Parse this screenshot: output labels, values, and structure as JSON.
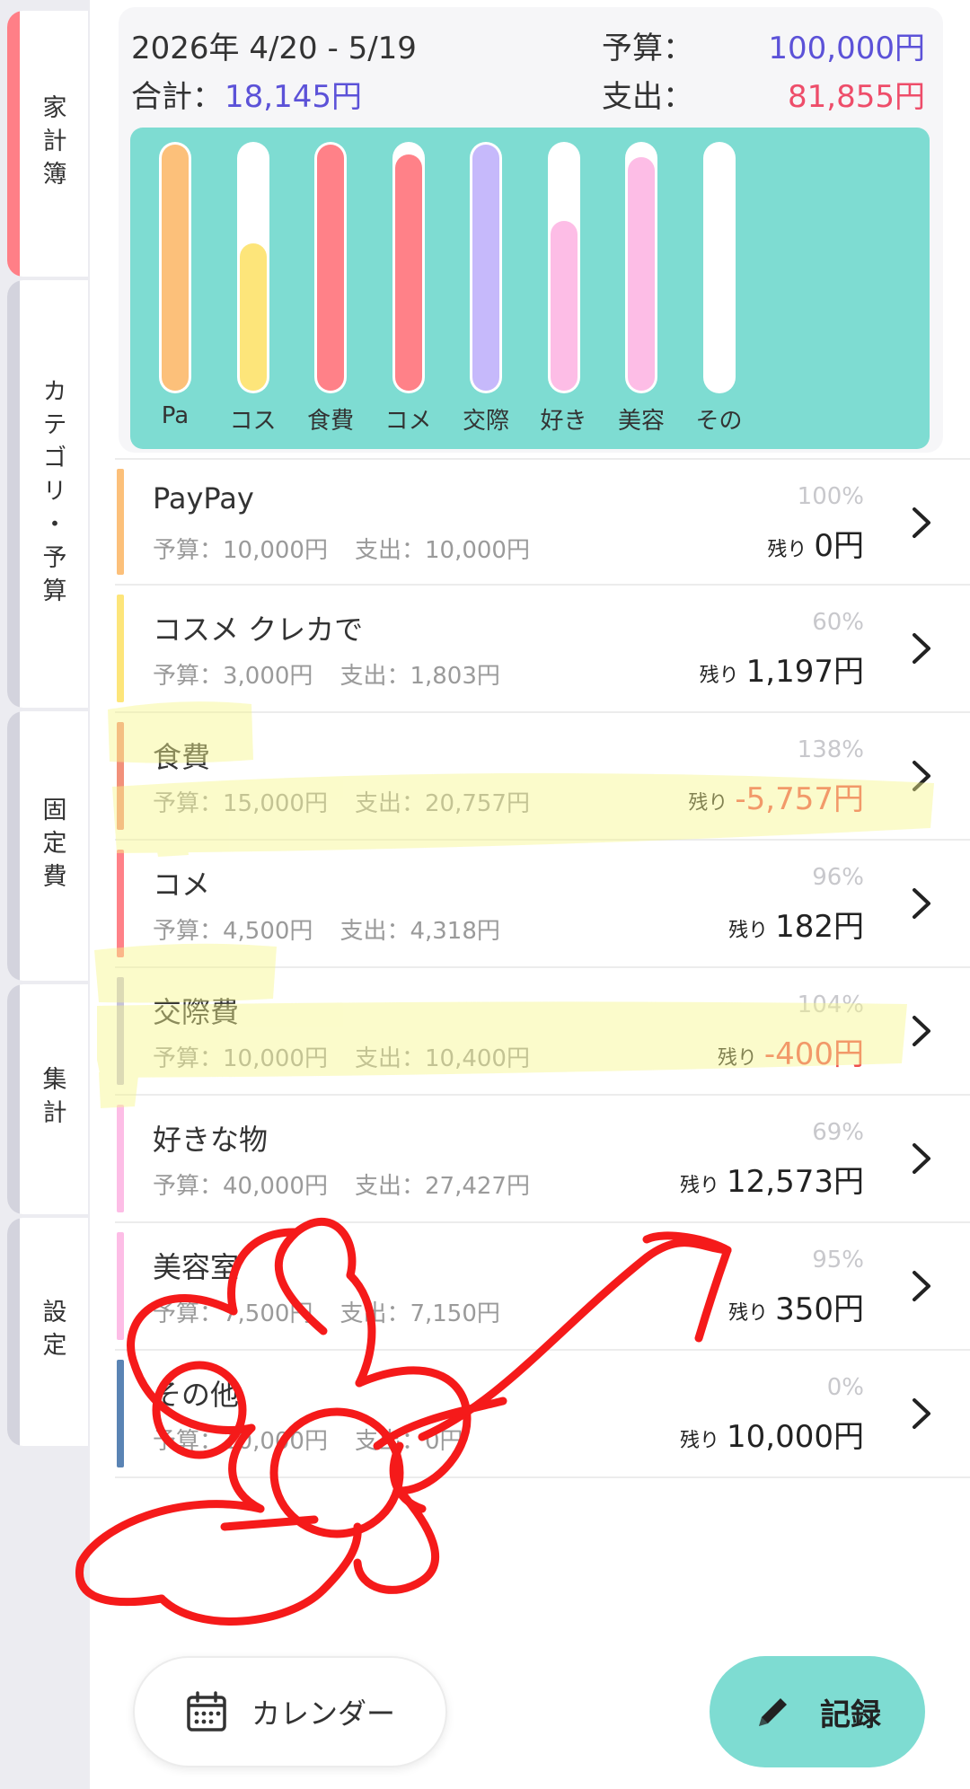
{
  "sidebar": {
    "tabs": [
      {
        "label": "家計簿",
        "active": true
      },
      {
        "label": "カテゴリ・予算",
        "active": false
      },
      {
        "label": "固定費",
        "active": false
      },
      {
        "label": "集計",
        "active": false
      },
      {
        "label": "設定",
        "active": false
      }
    ]
  },
  "summary": {
    "period": "2026年 4/20 - 5/19",
    "budget_label": "予算：",
    "budget_value": "100,000円",
    "total_label": "合計：",
    "total_value": "18,145円",
    "expense_label": "支出：",
    "expense_value": "81,855円"
  },
  "chart_data": {
    "type": "bar",
    "categories": [
      "Pa",
      "コス",
      "食費",
      "コメ",
      "交際",
      "好き",
      "美容",
      "その"
    ],
    "values": [
      100,
      60,
      100,
      96,
      100,
      69,
      95,
      0
    ],
    "ylim": [
      0,
      100
    ],
    "colors": [
      "#fcc07a",
      "#fde57a",
      "#ff8188",
      "#ff8188",
      "#c6b9fb",
      "#fdbde6",
      "#fdbde6",
      "#7b9fca"
    ]
  },
  "categories": [
    {
      "name": "PayPay",
      "budget": "予算：10,000円",
      "spent": "支出：10,000円",
      "percent": "100%",
      "remain_label": "残り",
      "remain": "0円",
      "negative": false,
      "color": "#fcc07a"
    },
    {
      "name": "コスメ クレカで",
      "budget": "予算：3,000円",
      "spent": "支出：1,803円",
      "percent": "60%",
      "remain_label": "残り",
      "remain": "1,197円",
      "negative": false,
      "color": "#fde57a"
    },
    {
      "name": "食費",
      "budget": "予算：15,000円",
      "spent": "支出：20,757円",
      "percent": "138%",
      "remain_label": "残り",
      "remain": "-5,757円",
      "negative": true,
      "color": "#f2907a"
    },
    {
      "name": "コメ",
      "budget": "予算：4,500円",
      "spent": "支出：4,318円",
      "percent": "96%",
      "remain_label": "残り",
      "remain": "182円",
      "negative": false,
      "color": "#ff8188"
    },
    {
      "name": "交際費",
      "budget": "予算：10,000円",
      "spent": "支出：10,400円",
      "percent": "104%",
      "remain_label": "残り",
      "remain": "-400円",
      "negative": true,
      "color": "#c6c2d8"
    },
    {
      "name": "好きな物",
      "budget": "予算：40,000円",
      "spent": "支出：27,427円",
      "percent": "69%",
      "remain_label": "残り",
      "remain": "12,573円",
      "negative": false,
      "color": "#fdbde6"
    },
    {
      "name": "美容室",
      "budget": "予算：7,500円",
      "spent": "支出：7,150円",
      "percent": "95%",
      "remain_label": "残り",
      "remain": "350円",
      "negative": false,
      "color": "#fdbde6"
    },
    {
      "name": "その他",
      "budget": "予算：10,000円",
      "spent": "支出：0円",
      "percent": "0%",
      "remain_label": "残り",
      "remain": "10,000円",
      "negative": false,
      "color": "#5a84b4"
    }
  ],
  "buttons": {
    "calendar": "カレンダー",
    "record": "記録"
  }
}
